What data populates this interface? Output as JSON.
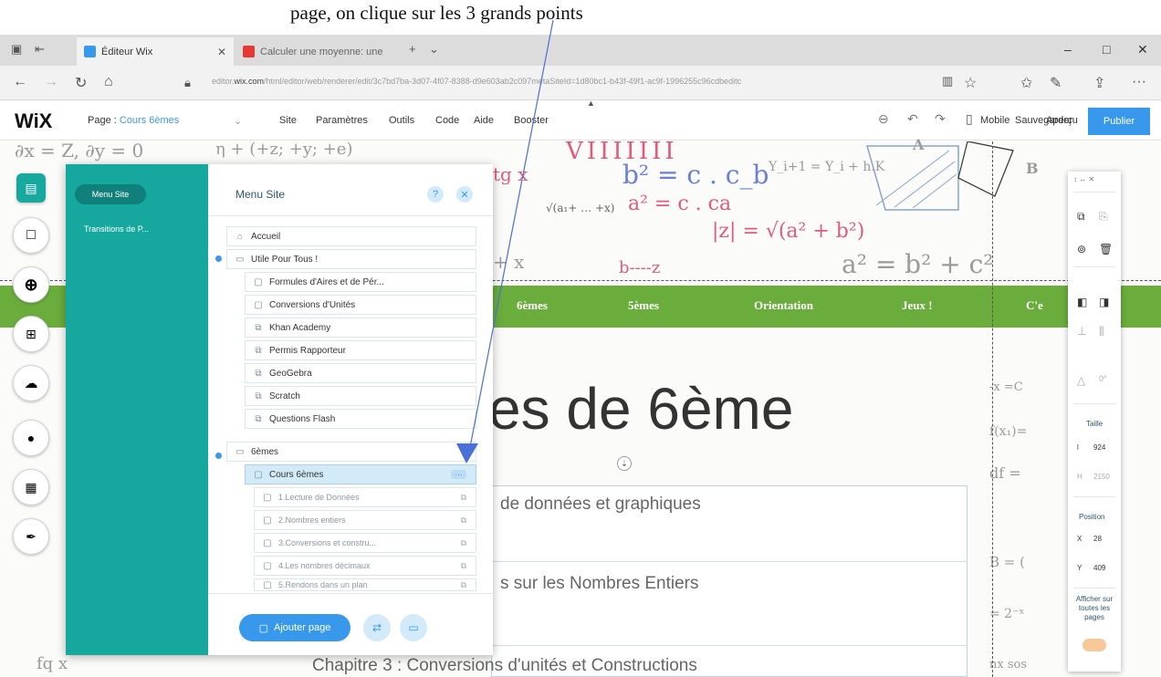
{
  "caption": {
    "text": "page, on clique sur les 3 grands points"
  },
  "browser": {
    "tabs": [
      {
        "label": "Éditeur Wix",
        "active": true
      },
      {
        "label": "Calculer une moyenne: une",
        "active": false
      }
    ],
    "url_domain": "wix.com",
    "url_prefix": "editor.",
    "url_rest": "/html/editor/web/renderer/edit/3c7bd7ba-3d07-4f07-8388-d9e603ab2c097metaSiteId=1d80bc1-b43f-49f1-ac9f-1996255c96cdbeditc"
  },
  "wix": {
    "logo": "WiX",
    "page_label": "Page :",
    "page_name": "Cours 6èmes",
    "menu": [
      "Site",
      "Paramètres",
      "Outils",
      "Code",
      "Aide",
      "Booster"
    ],
    "mobile": "Mobile",
    "save": "Sauvegarder",
    "preview": "Aperçu",
    "publish": "Publier"
  },
  "site_nav": [
    "6èmes",
    "5èmes",
    "Orientation",
    "Jeux !",
    "C'e"
  ],
  "page": {
    "title": "es de 6ème",
    "chapters": [
      "de données et graphiques",
      "s sur les Nombres Entiers",
      "Chapitre 3 : Conversions d'unités et Constructions"
    ]
  },
  "menu_panel": {
    "tabs": [
      "Menu Site",
      "Transitions de P..."
    ],
    "title": "Menu Site",
    "items": [
      {
        "label": "Accueil",
        "icon": "home-icon",
        "level": 0
      },
      {
        "label": "Utile Pour Tous !",
        "icon": "folder-icon",
        "level": 0
      },
      {
        "label": "Formules d'Aires et de Pér...",
        "icon": "page-icon",
        "level": 1
      },
      {
        "label": "Conversions d'Unités",
        "icon": "page-icon",
        "level": 1
      },
      {
        "label": "Khan Academy",
        "icon": "link-icon",
        "level": 1
      },
      {
        "label": "Permis Rapporteur",
        "icon": "link-icon",
        "level": 1
      },
      {
        "label": "GeoGebra",
        "icon": "link-icon",
        "level": 1
      },
      {
        "label": "Scratch",
        "icon": "link-icon",
        "level": 1
      },
      {
        "label": "Questions Flash",
        "icon": "link-icon",
        "level": 1
      },
      {
        "label": "6èmes",
        "icon": "folder-icon",
        "level": 0
      },
      {
        "label": "Cours 6èmes",
        "icon": "page-icon",
        "level": 1,
        "selected": true,
        "tail": "···"
      },
      {
        "label": "1.Lecture de Données",
        "icon": "page-icon",
        "level": 2,
        "tail": "⧉"
      },
      {
        "label": "2.Nombres entiers",
        "icon": "page-icon",
        "level": 2,
        "tail": "⧉"
      },
      {
        "label": "3.Conversions et constru...",
        "icon": "page-icon",
        "level": 2,
        "tail": "⧉"
      },
      {
        "label": "4.Les nombres décimaux",
        "icon": "page-icon",
        "level": 2,
        "tail": "⧉"
      },
      {
        "label": "5.Rendons dans un plan",
        "icon": "page-icon",
        "level": 2,
        "tail": "⧉"
      }
    ],
    "add_page": "Ajouter page"
  },
  "inspector": {
    "size_label": "Taille",
    "w_label": "l",
    "w_value": "924",
    "h_label": "H",
    "h_value": "2150",
    "position_label": "Position",
    "x_label": "X",
    "x_value": "28",
    "y_label": "Y",
    "y_value": "409",
    "show_all": "Afficher sur toutes les pages"
  },
  "colors": {
    "wix_teal": "#16a89f",
    "wix_blue": "#3899ec",
    "site_green": "#6aad3d"
  }
}
